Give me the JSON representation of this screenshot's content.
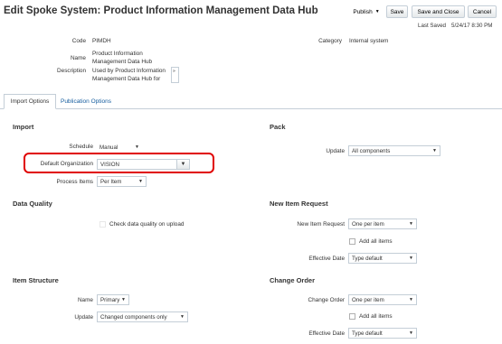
{
  "header": {
    "title": "Edit Spoke System: Product Information Management Data Hub",
    "publish_label": "Publish",
    "save_label": "Save",
    "save_close_label": "Save and Close",
    "cancel_label": "Cancel",
    "last_saved_label": "Last Saved",
    "last_saved_value": "5/24/17 8:30 PM"
  },
  "details": {
    "code_label": "Code",
    "code_value": "PIMDH",
    "name_label": "Name",
    "name_line1": "Product Information",
    "name_line2": "Management Data Hub",
    "description_label": "Description",
    "description_line1": "Used by Product Information",
    "description_line2": "Management Data Hub for",
    "category_label": "Category",
    "category_value": "Internal system"
  },
  "tabs": [
    {
      "label": "Import Options"
    },
    {
      "label": "Publication Options"
    }
  ],
  "import": {
    "heading": "Import",
    "schedule_label": "Schedule",
    "schedule_value": "Manual",
    "default_org_label": "Default Organization",
    "default_org_value": "VISION",
    "process_items_label": "Process Items",
    "process_items_value": "Per Item"
  },
  "pack": {
    "heading": "Pack",
    "update_label": "Update",
    "update_value": "All components"
  },
  "data_quality": {
    "heading": "Data Quality",
    "check_label": "Check data quality on upload"
  },
  "new_item_request": {
    "heading": "New Item Request",
    "request_label": "New Item Request",
    "request_value": "One per item",
    "add_all_label": "Add all items",
    "effective_date_label": "Effective Date",
    "effective_date_value": "Type default"
  },
  "item_structure": {
    "heading": "Item Structure",
    "name_label": "Name",
    "name_value": "Primary",
    "update_label": "Update",
    "update_value": "Changed components only"
  },
  "change_order": {
    "heading": "Change Order",
    "order_label": "Change Order",
    "order_value": "One per item",
    "add_all_label": "Add all items",
    "effective_date_label": "Effective Date",
    "effective_date_value": "Type default"
  },
  "colors": {
    "highlight": "#e00000",
    "link": "#145c9e"
  }
}
